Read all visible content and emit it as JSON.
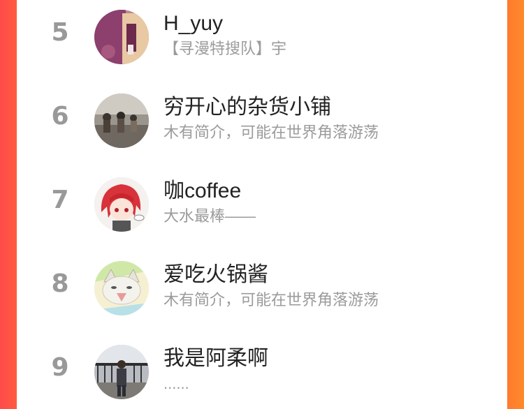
{
  "ranking": {
    "items": [
      {
        "rank": "5",
        "name": "H_yuy",
        "description": "【寻漫特搜队】宇",
        "avatar_icon": "room-photo-avatar-icon"
      },
      {
        "rank": "6",
        "name": "穷开心的杂货小铺",
        "description": "木有简介，可能在世界角落游荡",
        "avatar_icon": "crowd-photo-avatar-icon"
      },
      {
        "rank": "7",
        "name": "咖coffee",
        "description": "大水最棒——",
        "avatar_icon": "anime-girl-avatar-icon"
      },
      {
        "rank": "8",
        "name": "爱吃火锅酱",
        "description": "木有简介，可能在世界角落游荡",
        "avatar_icon": "cartoon-cat-avatar-icon"
      },
      {
        "rank": "9",
        "name": "我是阿柔啊",
        "description": "......",
        "avatar_icon": "person-street-avatar-icon"
      }
    ]
  }
}
